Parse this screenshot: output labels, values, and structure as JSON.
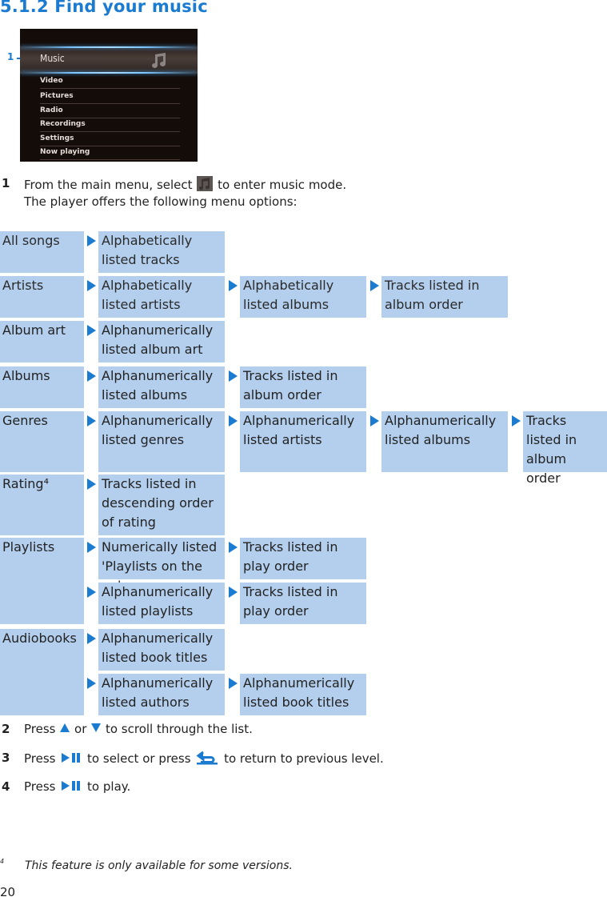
{
  "heading": "5.1.2 Find your music",
  "device": {
    "callout": "1",
    "selected_item": "Music",
    "selected_icon": "music-note-icon",
    "menu_items": [
      "Video",
      "Pictures",
      "Radio",
      "Recordings",
      "Settings",
      "Now playing"
    ]
  },
  "steps": [
    {
      "num": "1",
      "before": "From the main menu, select",
      "icon": "music-mode-icon",
      "after": "to enter music mode.",
      "line2": "The player offers the following menu options:"
    },
    {
      "num": "2",
      "t1": "Press",
      "icon1": "up-arrow-icon",
      "t2": "or",
      "icon2": "down-arrow-icon",
      "t3": "to scroll through the list."
    },
    {
      "num": "3",
      "t1": "Press",
      "icon1": "play-pause-icon",
      "t2": "to select or press",
      "icon2": "back-icon",
      "t3": "to return to previous level."
    },
    {
      "num": "4",
      "t1": "Press",
      "icon1": "play-pause-icon",
      "t2": "to play."
    }
  ],
  "menu_table": {
    "accent_color": "#1a7bd0",
    "cell_color": "#b3cfed",
    "rows": [
      {
        "category": "All songs",
        "levels": [
          [
            "Alphabetically\nlisted tracks"
          ]
        ]
      },
      {
        "category": "Artists",
        "levels": [
          [
            "Alphabetically\nlisted artists",
            "Alphabetically\nlisted albums",
            "Tracks listed in\nalbum order"
          ]
        ]
      },
      {
        "category": "Album art",
        "levels": [
          [
            "Alphanumerically\nlisted album art"
          ]
        ]
      },
      {
        "category": "Albums",
        "levels": [
          [
            "Alphanumerically\nlisted albums",
            "Tracks listed in\nalbum order"
          ]
        ]
      },
      {
        "category": "Genres",
        "levels": [
          [
            "Alphanumerically\nlisted genres",
            "Alphanumerically\nlisted artists",
            "Alphanumerically\nlisted albums",
            "Tracks\nlisted in\nalbum order"
          ]
        ]
      },
      {
        "category": "Rating⁴",
        "levels": [
          [
            "Tracks listed in\ndescending order\nof rating"
          ]
        ]
      },
      {
        "category": "Playlists",
        "levels": [
          [
            "Numerically listed\n'Playlists on the go'",
            "Tracks listed in\nplay order"
          ],
          [
            "Alphanumerically\nlisted playlists",
            "Tracks listed in\nplay order"
          ]
        ]
      },
      {
        "category": "Audiobooks",
        "levels": [
          [
            "Alphanumerically\nlisted book titles"
          ],
          [
            "Alphanumerically\nlisted authors",
            "Alphanumerically\nlisted book titles"
          ]
        ]
      }
    ]
  },
  "footnote": {
    "mark": "4",
    "text": "This feature is only available for some versions."
  },
  "page_number": "20"
}
